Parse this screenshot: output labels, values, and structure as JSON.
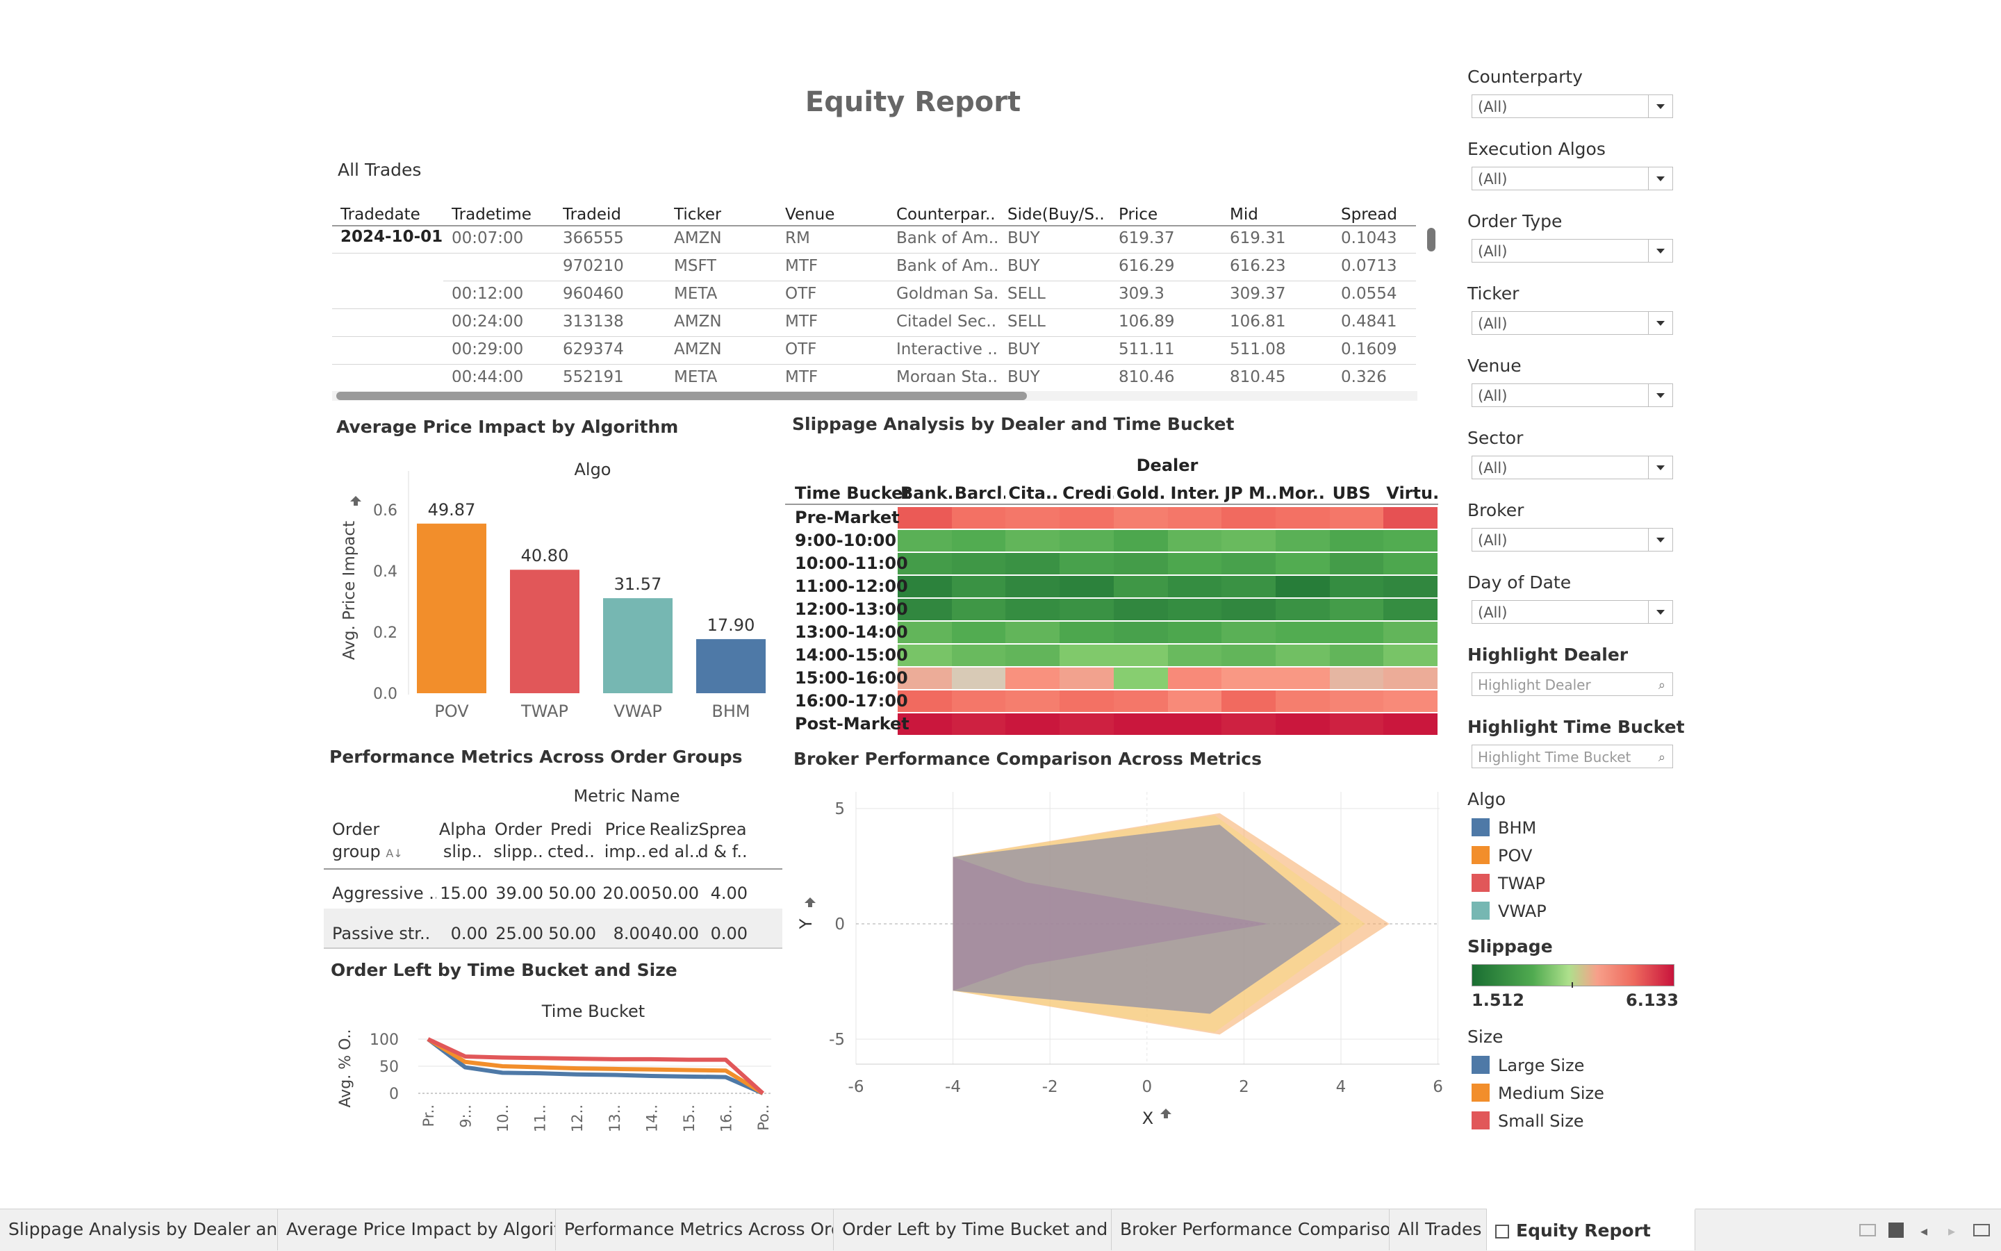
{
  "title": "Equity Report",
  "trades": {
    "title": "All Trades",
    "columns": [
      "Tradedate",
      "Tradetime",
      "Tradeid",
      "Ticker",
      "Venue",
      "Counterpar..",
      "Side(Buy/S..",
      "Price",
      "Mid",
      "Spread"
    ],
    "date": "2024-10-01",
    "rows": [
      {
        "time": "00:07:00",
        "id": "366555",
        "ticker": "AMZN",
        "venue": "RM",
        "cp": "Bank of Am..",
        "side": "BUY",
        "price": "619.37",
        "mid": "619.31",
        "spread": "0.1043"
      },
      {
        "time": "",
        "id": "970210",
        "ticker": "MSFT",
        "venue": "MTF",
        "cp": "Bank of Am..",
        "side": "BUY",
        "price": "616.29",
        "mid": "616.23",
        "spread": "0.0713"
      },
      {
        "time": "00:12:00",
        "id": "960460",
        "ticker": "META",
        "venue": "OTF",
        "cp": "Goldman Sa..",
        "side": "SELL",
        "price": "309.3",
        "mid": "309.37",
        "spread": "0.0554"
      },
      {
        "time": "00:24:00",
        "id": "313138",
        "ticker": "AMZN",
        "venue": "MTF",
        "cp": "Citadel Sec..",
        "side": "SELL",
        "price": "106.89",
        "mid": "106.81",
        "spread": "0.4841"
      },
      {
        "time": "00:29:00",
        "id": "629374",
        "ticker": "AMZN",
        "venue": "OTF",
        "cp": "Interactive ..",
        "side": "BUY",
        "price": "511.11",
        "mid": "511.08",
        "spread": "0.1609"
      },
      {
        "time": "00:44:00",
        "id": "552191",
        "ticker": "META",
        "venue": "MTF",
        "cp": "Morgan Sta..",
        "side": "BUY",
        "price": "810.46",
        "mid": "810.45",
        "spread": "0.326"
      }
    ]
  },
  "price_impact": {
    "title": "Average Price Impact by Algorithm",
    "header": "Algo",
    "ylabel": "Avg. Price Impact",
    "yticks": [
      "0.6",
      "0.4",
      "0.2",
      "0.0"
    ],
    "colors": [
      "#f28e2b",
      "#e15759",
      "#76b7b2",
      "#4e79a7"
    ]
  },
  "slippage": {
    "title": "Slippage Analysis by Dealer and Time Bucket",
    "header": "Dealer",
    "row_header": "Time Bucket",
    "dealers": [
      "Bank..",
      "Barcl..",
      "Cita..",
      "Credi..",
      "Gold..",
      "Inter..",
      "JP M..",
      "Mor..",
      "UBS",
      "Virtu.."
    ],
    "buckets": [
      "Pre-Market",
      "9:00-10:00",
      "10:00-11:00",
      "11:00-12:00",
      "12:00-13:00",
      "13:00-14:00",
      "14:00-15:00",
      "15:00-16:00",
      "16:00-17:00",
      "Post-Market"
    ]
  },
  "perf": {
    "title": "Performance Metrics Across Order Groups",
    "header": "Metric Name",
    "col0": [
      "Order",
      "group"
    ],
    "sort_glyph": "A↓",
    "cols": [
      [
        "Alpha",
        "slip.."
      ],
      [
        "Order",
        "slipp.."
      ],
      [
        "Predi",
        "cted.."
      ],
      [
        "Price",
        "imp.."
      ],
      [
        "Realiz",
        "ed al.."
      ],
      [
        "Sprea",
        "d & f.."
      ]
    ],
    "rows": [
      {
        "name": "Aggressive ..",
        "vals": [
          "15.00",
          "39.00",
          "50.00",
          "20.00",
          "50.00",
          "4.00"
        ]
      },
      {
        "name": "Passive str..",
        "vals": [
          "0.00",
          "25.00",
          "50.00",
          "8.00",
          "40.00",
          "0.00"
        ]
      }
    ]
  },
  "order_left": {
    "title": "Order Left by Time Bucket and Size",
    "header": "Time Bucket",
    "ylabel": "Avg. % O..",
    "yticks": [
      "100",
      "50",
      "0"
    ],
    "xticks": [
      "Pr..",
      "9:..",
      "10..",
      "11..",
      "12..",
      "13..",
      "14..",
      "15..",
      "16..",
      "Po.."
    ]
  },
  "broker": {
    "title": "Broker Performance Comparison Across Metrics",
    "xlabel": "X",
    "ylabel": "Y",
    "xticks": [
      "-6",
      "-4",
      "-2",
      "0",
      "2",
      "4",
      "6"
    ],
    "yticks": [
      "5",
      "0",
      "-5"
    ]
  },
  "filters": [
    {
      "label": "Counterparty",
      "value": "(All)"
    },
    {
      "label": "Execution Algos",
      "value": "(All)"
    },
    {
      "label": "Order Type",
      "value": "(All)"
    },
    {
      "label": "Ticker",
      "value": "(All)"
    },
    {
      "label": "Venue",
      "value": "(All)"
    },
    {
      "label": "Sector",
      "value": "(All)"
    },
    {
      "label": "Broker",
      "value": "(All)"
    },
    {
      "label": "Day of Date",
      "value": "(All)"
    }
  ],
  "highlights": [
    {
      "label": "Highlight Dealer",
      "placeholder": "Highlight Dealer"
    },
    {
      "label": "Highlight Time Bucket",
      "placeholder": "Highlight Time Bucket"
    }
  ],
  "algo_legend": {
    "title": "Algo",
    "items": [
      {
        "name": "BHM",
        "color": "#4e79a7"
      },
      {
        "name": "POV",
        "color": "#f28e2b"
      },
      {
        "name": "TWAP",
        "color": "#e15759"
      },
      {
        "name": "VWAP",
        "color": "#76b7b2"
      }
    ]
  },
  "slippage_legend": {
    "title": "Slippage",
    "min": "1.512",
    "max": "6.133"
  },
  "size_legend": {
    "title": "Size",
    "items": [
      {
        "name": "Large Size",
        "color": "#4e79a7"
      },
      {
        "name": "Medium Size",
        "color": "#f28e2b"
      },
      {
        "name": "Small Size",
        "color": "#e15759"
      }
    ]
  },
  "tabs": [
    {
      "label": "Slippage Analysis by Dealer and ..."
    },
    {
      "label": "Average Price Impact by Algorith..."
    },
    {
      "label": "Performance Metrics Across Ord..."
    },
    {
      "label": "Order Left by Time Bucket and S..."
    },
    {
      "label": "Broker Performance Compariso..."
    },
    {
      "label": "All Trades"
    },
    {
      "label": "Equity Report"
    }
  ],
  "chart_data": [
    {
      "type": "bar",
      "title": "Average Price Impact by Algorithm",
      "categories": [
        "POV",
        "TWAP",
        "VWAP",
        "BHM"
      ],
      "values": [
        0.555,
        0.404,
        0.311,
        0.177
      ],
      "labels": [
        "49.87",
        "40.80",
        "31.57",
        "17.90"
      ],
      "ylabel": "Avg. Price Impact",
      "ylim": [
        0,
        0.65
      ]
    },
    {
      "type": "heatmap",
      "title": "Slippage Analysis by Dealer and Time Bucket",
      "x": [
        "Bank..",
        "Barcl..",
        "Cita..",
        "Credi..",
        "Gold..",
        "Inter..",
        "JP M..",
        "Mor..",
        "UBS",
        "Virtu.."
      ],
      "y": [
        "Pre-Market",
        "9:00-10:00",
        "10:00-11:00",
        "11:00-12:00",
        "12:00-13:00",
        "13:00-14:00",
        "14:00-15:00",
        "15:00-16:00",
        "16:00-17:00",
        "Post-Market"
      ],
      "values": [
        [
          5.4,
          5.1,
          5.0,
          5.1,
          4.9,
          5.0,
          5.2,
          5.1,
          5.0,
          5.5
        ],
        [
          2.8,
          2.7,
          2.9,
          2.8,
          2.6,
          2.9,
          3.0,
          2.8,
          2.6,
          2.7
        ],
        [
          2.4,
          2.3,
          2.2,
          2.5,
          2.4,
          2.6,
          2.5,
          2.7,
          2.4,
          2.6
        ],
        [
          1.9,
          2.2,
          2.0,
          1.9,
          2.3,
          2.1,
          2.2,
          1.8,
          2.1,
          2.0
        ],
        [
          2.0,
          2.3,
          2.1,
          2.2,
          2.0,
          2.1,
          2.0,
          2.2,
          2.4,
          2.1
        ],
        [
          2.9,
          2.7,
          2.9,
          2.6,
          2.5,
          2.6,
          2.8,
          2.7,
          2.7,
          2.9
        ],
        [
          3.2,
          3.0,
          2.9,
          3.3,
          3.3,
          3.0,
          2.9,
          3.1,
          2.9,
          3.2
        ],
        [
          4.3,
          4.0,
          4.6,
          4.4,
          3.4,
          4.7,
          4.5,
          4.5,
          4.2,
          4.3
        ],
        [
          5.2,
          5.0,
          4.9,
          5.1,
          5.0,
          4.7,
          5.2,
          4.9,
          4.8,
          4.7
        ],
        [
          6.1,
          6.0,
          6.1,
          6.0,
          6.1,
          6.1,
          6.0,
          6.1,
          6.0,
          6.1
        ]
      ],
      "range": [
        1.512,
        6.133
      ]
    },
    {
      "type": "line",
      "title": "Order Left by Time Bucket and Size",
      "categories": [
        "Pr..",
        "9:..",
        "10..",
        "11..",
        "12..",
        "13..",
        "14..",
        "15..",
        "16..",
        "Po.."
      ],
      "series": [
        {
          "name": "Large Size",
          "values": [
            100,
            48,
            38,
            37,
            35,
            34,
            32,
            31,
            30,
            0
          ]
        },
        {
          "name": "Medium Size",
          "values": [
            100,
            58,
            50,
            48,
            46,
            45,
            44,
            43,
            42,
            0
          ]
        },
        {
          "name": "Small Size",
          "values": [
            100,
            68,
            66,
            65,
            64,
            63,
            63,
            62,
            62,
            0
          ]
        }
      ],
      "ylabel": "Avg. % O..",
      "ylim": [
        0,
        110
      ]
    },
    {
      "type": "area",
      "title": "Broker Performance Comparison Across Metrics",
      "xlabel": "X",
      "ylabel": "Y",
      "xlim": [
        -6,
        6
      ],
      "ylim": [
        -6,
        6
      ],
      "series": [
        {
          "name": "POV",
          "points": [
            [
              -4,
              2.9
            ],
            [
              1.5,
              4.8
            ],
            [
              5,
              0
            ],
            [
              1.5,
              -4.8
            ],
            [
              -4,
              -2.9
            ]
          ]
        },
        {
          "name": "VWAP",
          "points": [
            [
              -4,
              2.9
            ],
            [
              1.4,
              4.7
            ],
            [
              4.5,
              0
            ],
            [
              1.4,
              -4.7
            ],
            [
              -4,
              -2.9
            ]
          ]
        },
        {
          "name": "TWAP",
          "points": [
            [
              -4,
              2.9
            ],
            [
              -2.5,
              1.8
            ],
            [
              2.5,
              0
            ],
            [
              -2.5,
              -1.8
            ],
            [
              -4,
              -2.9
            ]
          ]
        },
        {
          "name": "BHM",
          "points": [
            [
              -4,
              2.9
            ],
            [
              1.5,
              4.3
            ],
            [
              4,
              0
            ],
            [
              1.3,
              -3.9
            ],
            [
              -4,
              -2.9
            ]
          ]
        }
      ]
    }
  ]
}
